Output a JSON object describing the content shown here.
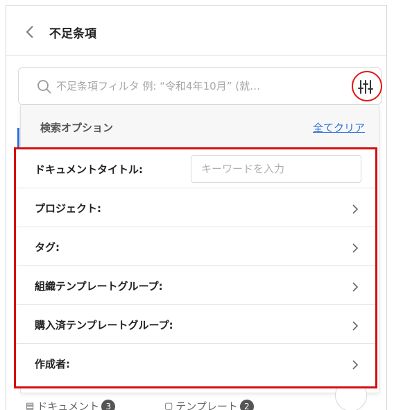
{
  "header": {
    "title": "不足条項"
  },
  "search": {
    "placeholder": "不足条項フィルタ 例: “令和4年10月” (就…"
  },
  "panel": {
    "title": "検索オプション",
    "clear_label": "全てクリア",
    "options": [
      {
        "label": "ドキュメントタイトル:",
        "input_placeholder": "キーワードを入力"
      },
      {
        "label": "プロジェクト:"
      },
      {
        "label": "タグ:"
      },
      {
        "label": "組織テンプレートグループ:"
      },
      {
        "label": "購入済テンプレートグループ:"
      },
      {
        "label": "作成者:"
      }
    ]
  },
  "footer_tabs": [
    {
      "label": "ドキュメント",
      "count": "3"
    },
    {
      "label": "テンプレート",
      "count": "2"
    }
  ],
  "colors": {
    "accent": "#2c73d6",
    "highlight": "#d40f0f"
  }
}
